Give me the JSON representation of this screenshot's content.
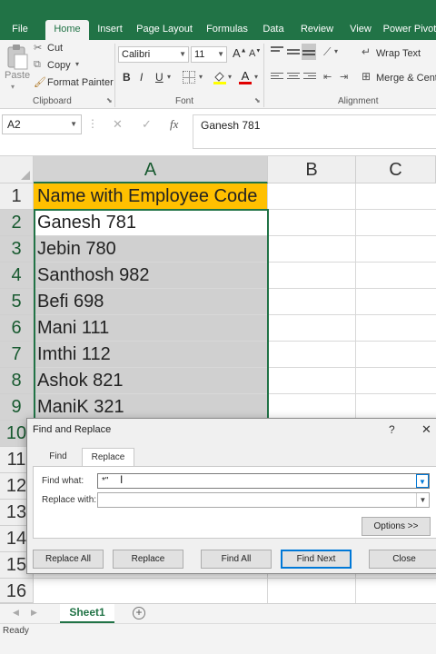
{
  "ribbon_tabs": [
    "File",
    "Home",
    "Insert",
    "Page Layout",
    "Formulas",
    "Data",
    "Review",
    "View",
    "Power Pivot"
  ],
  "clipboard": {
    "paste": "Paste",
    "cut": "Cut",
    "copy": "Copy",
    "format_painter": "Format Painter",
    "group_label": "Clipboard"
  },
  "font": {
    "family": "Calibri",
    "size": "11",
    "bold": "B",
    "italic": "I",
    "underline": "U",
    "grow": "A",
    "shrink": "A",
    "color_letter": "A",
    "group_label": "Font"
  },
  "alignment": {
    "wrap_text": "Wrap Text",
    "merge_center": "Merge & Cente",
    "group_label": "Alignment"
  },
  "formula_bar": {
    "name_box": "A2",
    "fx": "fx",
    "content": "Ganesh 781"
  },
  "columns": [
    "A",
    "B",
    "C"
  ],
  "rows": [
    "1",
    "2",
    "3",
    "4",
    "5",
    "6",
    "7",
    "8",
    "9",
    "10",
    "11",
    "12",
    "13",
    "14",
    "15",
    "16"
  ],
  "cells_a": [
    "Name with Employee Code",
    "Ganesh 781",
    "Jebin 780",
    "Santhosh 982",
    "Befi 698",
    "Mani 111",
    "Imthi 112",
    "Ashok 821",
    "ManiK 321"
  ],
  "sheet_tab": "Sheet1",
  "status": "Ready",
  "dialog": {
    "title": "Find and Replace",
    "help": "?",
    "close_x": "✕",
    "tabs": [
      "Find",
      "Replace"
    ],
    "find_label": "Find what:",
    "find_value": "*\"",
    "replace_label": "Replace with:",
    "replace_value": "",
    "options": "Options >>",
    "buttons": {
      "replace_all": "Replace All",
      "replace": "Replace",
      "find_all": "Find All",
      "find_next": "Find Next",
      "close": "Close"
    }
  },
  "colors": {
    "excel_green": "#217346",
    "header_fill": "#ffc000",
    "selection_fill": "#d0d0d0",
    "accent_blue": "#0078d7"
  }
}
